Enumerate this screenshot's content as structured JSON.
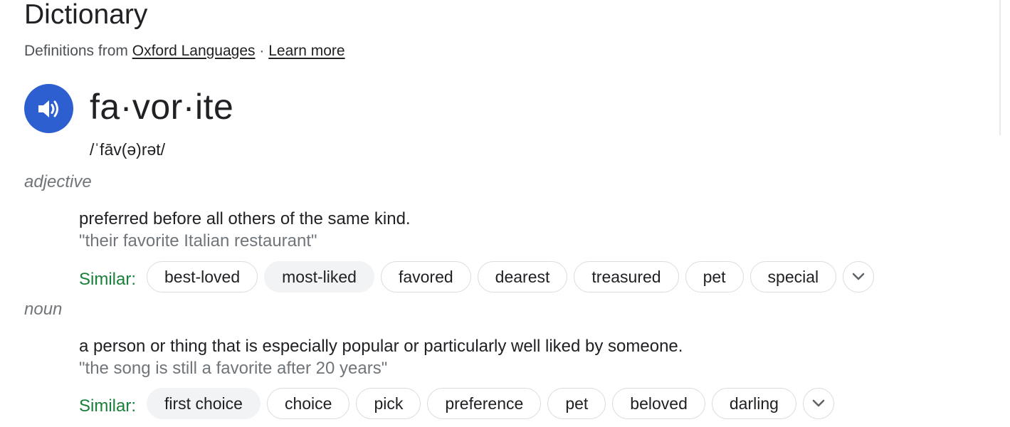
{
  "header": {
    "title": "Dictionary",
    "source_prefix": "Definitions from",
    "source_link": "Oxford Languages",
    "separator": "·",
    "learn_more": "Learn more"
  },
  "entry": {
    "headword": "fa·vor·ite",
    "phonetic": "/ˈfāv(ə)rət/",
    "speaker_icon": "speaker-icon"
  },
  "senses": [
    {
      "part_of_speech": "adjective",
      "definition": "preferred before all others of the same kind.",
      "example": "\"their favorite Italian restaurant\"",
      "similar_label": "Similar:",
      "similar": [
        "best-loved",
        "most-liked",
        "favored",
        "dearest",
        "treasured",
        "pet",
        "special"
      ]
    },
    {
      "part_of_speech": "noun",
      "definition": "a person or thing that is especially popular or particularly well liked by someone.",
      "example": "\"the song is still a favorite after 20 years\"",
      "similar_label": "Similar:",
      "similar": [
        "first choice",
        "choice",
        "pick",
        "preference",
        "pet",
        "beloved",
        "darling"
      ]
    }
  ],
  "colors": {
    "accent_blue": "#2e5fd0",
    "similar_green": "#188038",
    "muted_gray": "#70757a",
    "chip_border": "#dadce0",
    "chip_shaded": "#f1f3f4"
  }
}
